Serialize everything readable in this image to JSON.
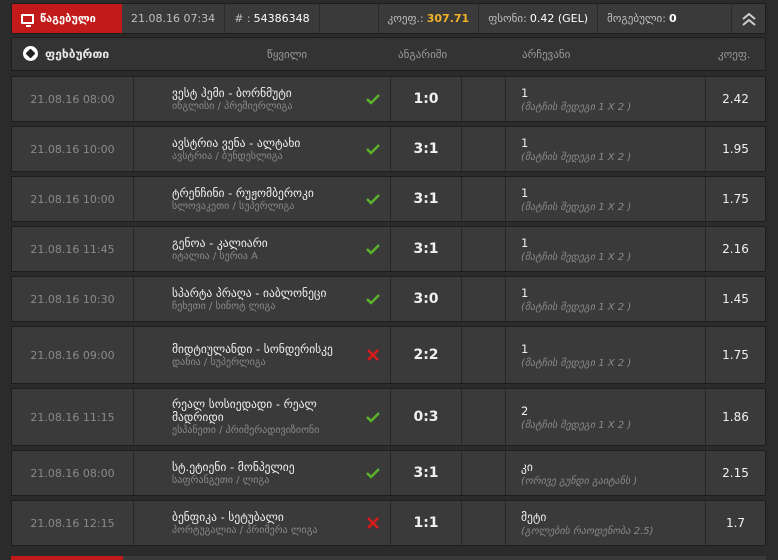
{
  "topbar": {
    "active_tab": "წაგებული",
    "datetime": "21.08.16 07:34",
    "ticket_prefix": "# :",
    "ticket_id": "54386348",
    "odds_label": "კოეფ.:",
    "odds_value": "307.71",
    "stake_label": "ფსონი:",
    "stake_value": "0.42 (GEL)",
    "win_label": "მოგებული:",
    "win_value": "0"
  },
  "header": {
    "sport": "ფეხბურთი",
    "col_event": "წყვილი",
    "col_score": "ანგარიში",
    "col_pick": "არჩევანი",
    "col_odd": "კოეფ."
  },
  "colors": {
    "accent": "#c21a1a",
    "win": "#5cb32a",
    "loss": "#d81c1c",
    "highlight": "#f2b227"
  },
  "rows": [
    {
      "date": "21.08.16 08:00",
      "teams": "ვესტ ჰემი - ბორნმუტი",
      "league": "ინგლისი / პრემიერლიგა",
      "status": "win",
      "status_icon": "check-icon",
      "score": "1:0",
      "pick": "1",
      "desc": "(მატჩის შედეგი 1 X 2 )",
      "odd": "2.42"
    },
    {
      "date": "21.08.16 10:00",
      "teams": "ავსტრია ვენა - ალტახი",
      "league": "ავსტრია / ბუნდესლიგა",
      "status": "win",
      "status_icon": "check-icon",
      "score": "3:1",
      "pick": "1",
      "desc": "(მატჩის შედეგი 1 X 2 )",
      "odd": "1.95"
    },
    {
      "date": "21.08.16 10:00",
      "teams": "ტრენჩინი - რუჟომბეროკი",
      "league": "სლოვაკეთი / სუპერლიგა",
      "status": "win",
      "status_icon": "check-icon",
      "score": "3:1",
      "pick": "1",
      "desc": "(მატჩის შედეგი 1 X 2 )",
      "odd": "1.75"
    },
    {
      "date": "21.08.16 11:45",
      "teams": "გენოა - კალიარი",
      "league": "იტალია / სერია A",
      "status": "win",
      "status_icon": "check-icon",
      "score": "3:1",
      "pick": "1",
      "desc": "(მატჩის შედეგი 1 X 2 )",
      "odd": "2.16"
    },
    {
      "date": "21.08.16 10:30",
      "teams": "სპარტა პრაღა - იაბლონეცი",
      "league": "ჩეხეთი / სინოტ ლიგა",
      "status": "win",
      "status_icon": "check-icon",
      "score": "3:0",
      "pick": "1",
      "desc": "(მატჩის შედეგი 1 X 2 )",
      "odd": "1.45"
    },
    {
      "date": "21.08.16 09:00",
      "teams": "მიდტიულანდი - სონდერისკე",
      "league": "დანია / სუპერლიგა",
      "status": "loss",
      "status_icon": "cross-icon",
      "score": "2:2",
      "pick": "1",
      "desc": "(მატჩის შედეგი 1 X 2 )",
      "odd": "1.75"
    },
    {
      "date": "21.08.16 11:15",
      "teams": "რეალ სოსიედადი - რეალ მადრიდი",
      "league": "ესპანეთი / პრიმერადივიზიონი",
      "status": "win",
      "status_icon": "check-icon",
      "score": "0:3",
      "pick": "2",
      "desc": "(მატჩის შედეგი 1 X 2 )",
      "odd": "1.86"
    },
    {
      "date": "21.08.16 08:00",
      "teams": "სტ.ეტიენი - მონპელიე",
      "league": "საფრანგეთი / ლიგა",
      "status": "win",
      "status_icon": "check-icon",
      "score": "3:1",
      "pick": "კი",
      "desc": "(ორივე გუნდი გაიტანს )",
      "odd": "2.15"
    },
    {
      "date": "21.08.16 12:15",
      "teams": "ბენფიკა - სეტუბალი",
      "league": "პორტუგალია / პრიმერა ლიგა",
      "status": "loss",
      "status_icon": "cross-icon",
      "score": "1:1",
      "pick": "მეტი",
      "desc": "(გოლების რაოდენობა 2.5)",
      "odd": "1.7"
    }
  ]
}
